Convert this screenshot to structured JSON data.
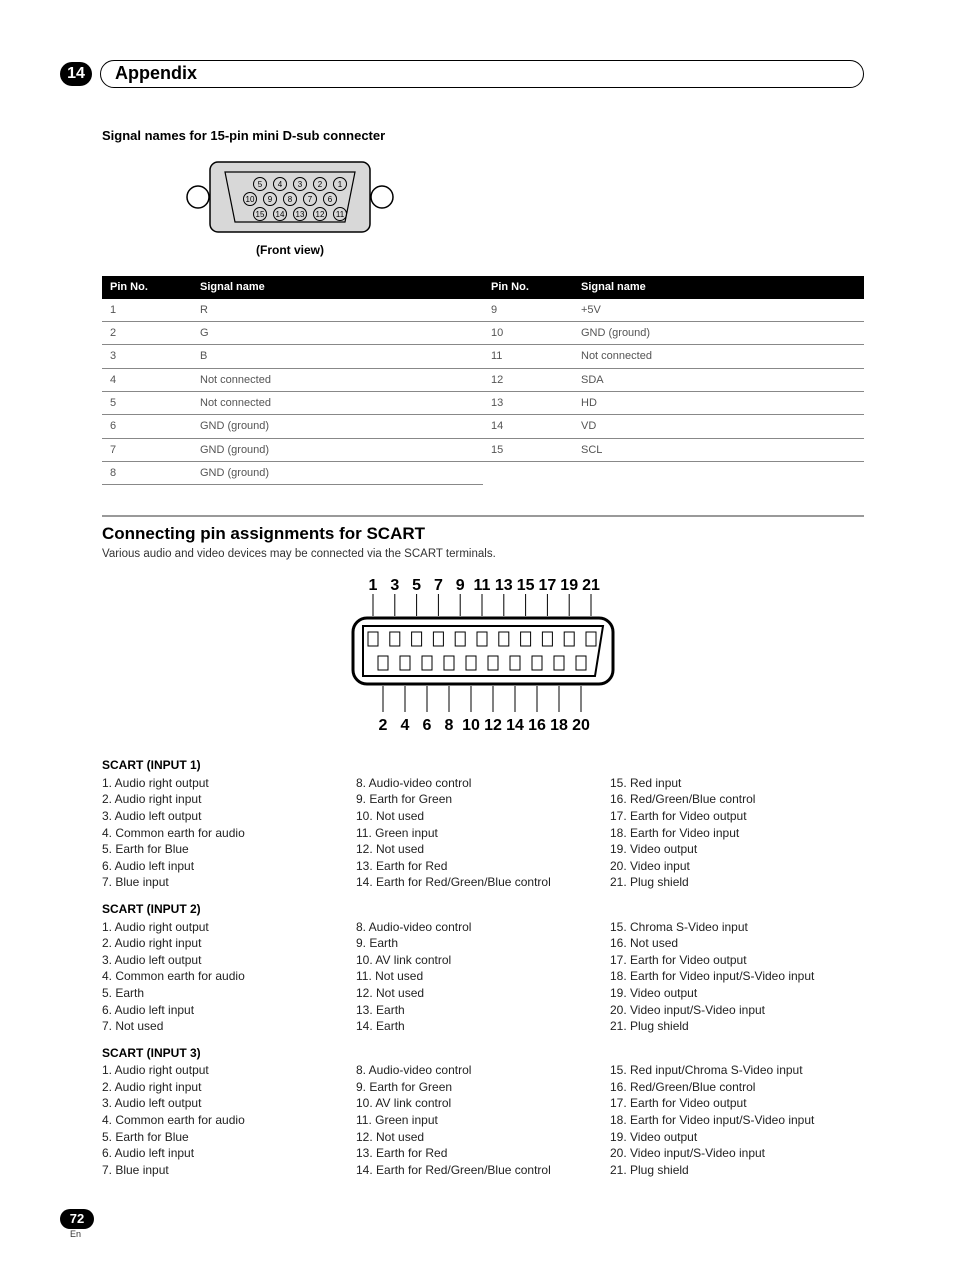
{
  "chapter": {
    "number": "14",
    "title": "Appendix"
  },
  "dsub": {
    "title": "Signal names for 15-pin mini D-sub connecter",
    "caption": "(Front view)",
    "headers": {
      "pin": "Pin No.",
      "signal": "Signal name"
    },
    "left": [
      {
        "pin": "1",
        "signal": "R"
      },
      {
        "pin": "2",
        "signal": "G"
      },
      {
        "pin": "3",
        "signal": "B"
      },
      {
        "pin": "4",
        "signal": "Not connected"
      },
      {
        "pin": "5",
        "signal": "Not connected"
      },
      {
        "pin": "6",
        "signal": "GND (ground)"
      },
      {
        "pin": "7",
        "signal": "GND (ground)"
      },
      {
        "pin": "8",
        "signal": "GND (ground)"
      }
    ],
    "right": [
      {
        "pin": "9",
        "signal": "+5V"
      },
      {
        "pin": "10",
        "signal": "GND (ground)"
      },
      {
        "pin": "11",
        "signal": "Not connected"
      },
      {
        "pin": "12",
        "signal": "SDA"
      },
      {
        "pin": "13",
        "signal": "HD"
      },
      {
        "pin": "14",
        "signal": "VD"
      },
      {
        "pin": "15",
        "signal": "SCL"
      }
    ]
  },
  "scart": {
    "heading": "Connecting pin assignments for SCART",
    "desc": "Various audio and video devices may be connected via the SCART terminals.",
    "top_labels": [
      "1",
      "3",
      "5",
      "7",
      "9",
      "11",
      "13",
      "15",
      "17",
      "19",
      "21"
    ],
    "bottom_labels": [
      "2",
      "4",
      "6",
      "8",
      "10",
      "12",
      "14",
      "16",
      "18",
      "20"
    ],
    "groups": [
      {
        "title": "SCART (INPUT 1)",
        "col1": [
          "1.  Audio right output",
          "2.  Audio right input",
          "3.  Audio left output",
          "4.  Common earth for audio",
          "5.  Earth for Blue",
          "6.  Audio left input",
          "7.  Blue input"
        ],
        "col2": [
          "8.  Audio-video control",
          "9.  Earth for Green",
          "10. Not used",
          "11. Green input",
          "12. Not used",
          "13. Earth for Red",
          "14. Earth for Red/Green/Blue control"
        ],
        "col3": [
          "15. Red input",
          "16. Red/Green/Blue control",
          "17. Earth for Video output",
          "18. Earth for Video input",
          "19. Video output",
          "20. Video input",
          "21. Plug shield"
        ]
      },
      {
        "title": "SCART (INPUT 2)",
        "col1": [
          "1.  Audio right output",
          "2.  Audio right input",
          "3.  Audio left output",
          "4.  Common earth for audio",
          "5.  Earth",
          "6.  Audio left input",
          "7.  Not used"
        ],
        "col2": [
          "8.  Audio-video control",
          "9.  Earth",
          "10. AV link control",
          "11. Not used",
          "12. Not used",
          "13. Earth",
          "14. Earth"
        ],
        "col3": [
          "15. Chroma S-Video input",
          "16. Not used",
          "17. Earth for Video output",
          "18. Earth for Video input/S-Video input",
          "19. Video output",
          "20. Video input/S-Video input",
          "21. Plug shield"
        ]
      },
      {
        "title": "SCART (INPUT 3)",
        "col1": [
          "1.  Audio right output",
          "2.  Audio right input",
          "3.  Audio left output",
          "4.  Common earth for audio",
          "5.  Earth for Blue",
          "6.  Audio left input",
          "7.  Blue input"
        ],
        "col2": [
          "8.  Audio-video control",
          "9.  Earth for Green",
          "10. AV link control",
          "11. Green input",
          "12. Not used",
          "13. Earth for Red",
          "14. Earth for Red/Green/Blue control"
        ],
        "col3": [
          "15. Red input/Chroma S-Video input",
          "16. Red/Green/Blue control",
          "17. Earth for Video output",
          "18. Earth for Video input/S-Video input",
          "19. Video output",
          "20. Video input/S-Video input",
          "21. Plug shield"
        ]
      }
    ]
  },
  "footer": {
    "page": "72",
    "lang": "En"
  }
}
